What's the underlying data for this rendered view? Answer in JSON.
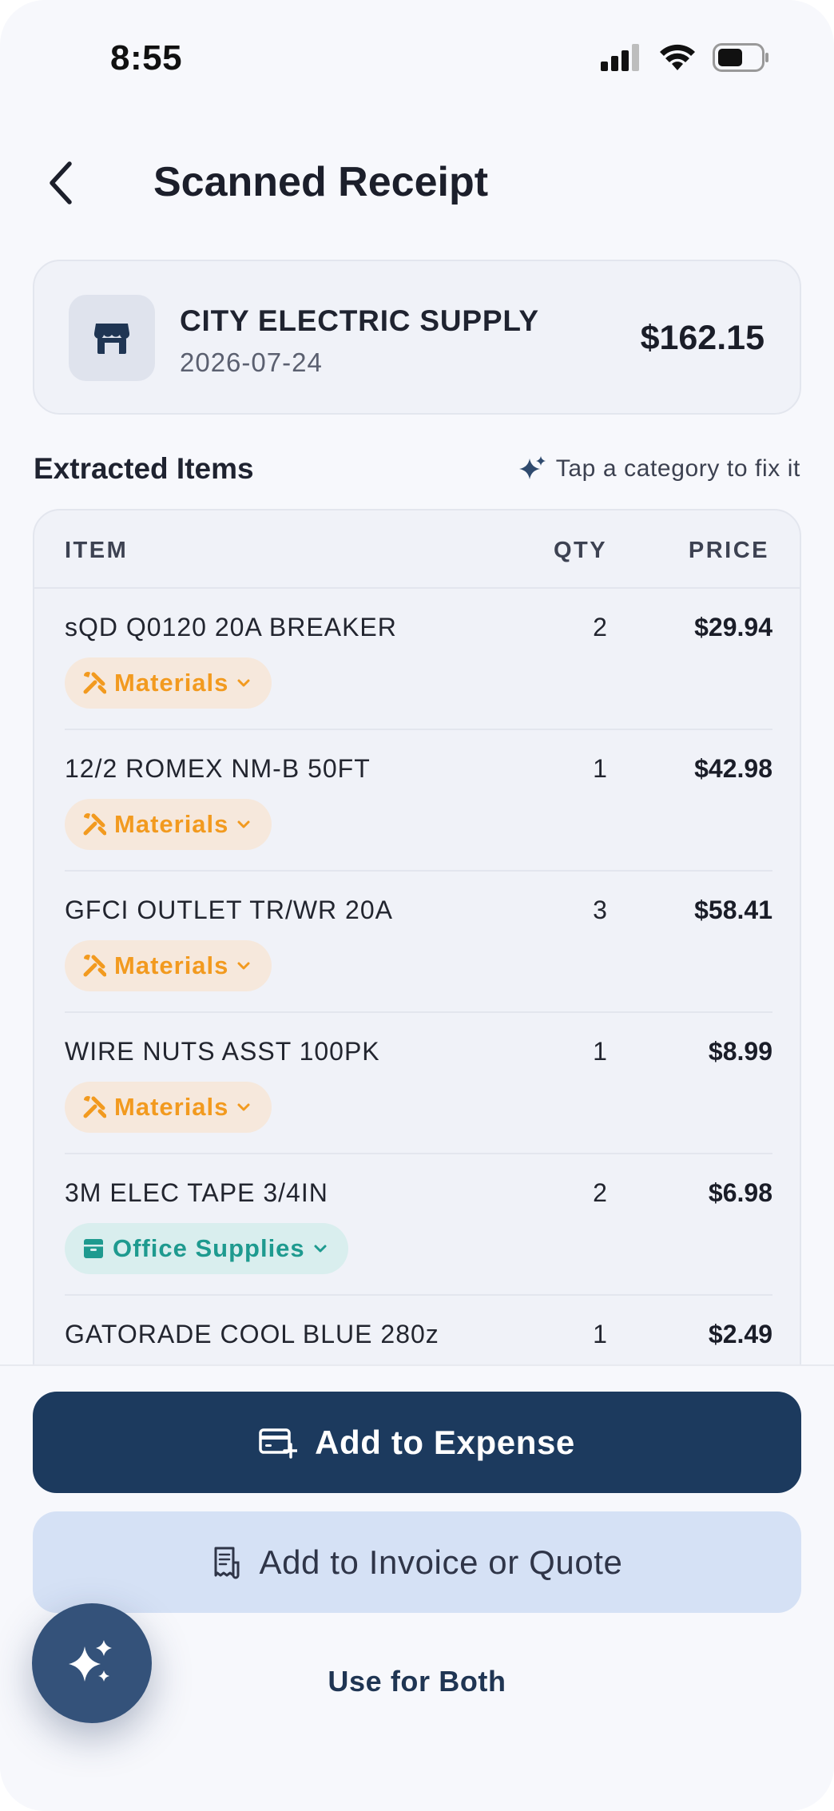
{
  "status_bar": {
    "time": "8:55"
  },
  "header": {
    "title": "Scanned Receipt"
  },
  "store": {
    "name": "CITY ELECTRIC SUPPLY",
    "date": "2026-07-24",
    "total": "$162.15"
  },
  "items_section": {
    "heading": "Extracted Items",
    "hint": "Tap a category to fix it"
  },
  "table": {
    "columns": {
      "item": "ITEM",
      "qty": "QTY",
      "price": "PRICE"
    },
    "rows": [
      {
        "name": "sQD Q0120 20A BREAKER",
        "qty": "2",
        "price": "$29.94",
        "category": "Materials",
        "category_type": "materials"
      },
      {
        "name": "12/2 ROMEX NM-B 50FT",
        "qty": "1",
        "price": "$42.98",
        "category": "Materials",
        "category_type": "materials"
      },
      {
        "name": "GFCI OUTLET TR/WR 20A",
        "qty": "3",
        "price": "$58.41",
        "category": "Materials",
        "category_type": "materials"
      },
      {
        "name": "WIRE NUTS ASST 100PK",
        "qty": "1",
        "price": "$8.99",
        "category": "Materials",
        "category_type": "materials"
      },
      {
        "name": "3M ELEC TAPE 3/4IN",
        "qty": "2",
        "price": "$6.98",
        "category": "Office Supplies",
        "category_type": "office"
      },
      {
        "name": "GATORADE COOL BLUE 280z",
        "qty": "1",
        "price": "$2.49"
      }
    ]
  },
  "actions": {
    "add_expense": "Add to Expense",
    "add_invoice": "Add to Invoice or Quote",
    "use_both": "Use for Both"
  },
  "colors": {
    "primary": "#1c3a5e",
    "secondary": "#d5e1f5",
    "materials": "#f29a1f",
    "office": "#1e9a8f"
  }
}
